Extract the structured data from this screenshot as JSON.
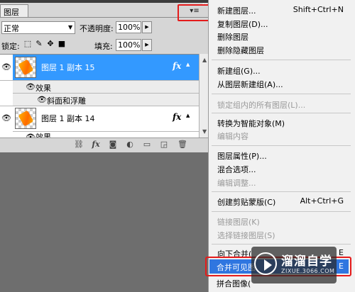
{
  "panel": {
    "tab_label": "图层",
    "menu_button_glyph": "▾≡",
    "blend_mode": "正常",
    "opacity_label": "不透明度:",
    "opacity_value": "100%",
    "lock_label": "锁定:",
    "fill_label": "填充:",
    "fill_value": "100%",
    "layers": [
      {
        "name": "图层 1 副本 15",
        "selected": true,
        "effects_label": "效果",
        "effect_item": "斜面和浮雕"
      },
      {
        "name": "图层 1 副本 14",
        "selected": false,
        "effects_label": "效果"
      }
    ],
    "fx_glyph": "fx"
  },
  "menu": {
    "items": [
      {
        "label": "新建图层...",
        "shortcut": "Shift+Ctrl+N",
        "disabled": false
      },
      {
        "label": "复制图层(D)...",
        "disabled": false
      },
      {
        "label": "删除图层",
        "disabled": false
      },
      {
        "label": "删除隐藏图层",
        "disabled": false
      },
      {
        "label": "新建组(G)...",
        "disabled": false
      },
      {
        "label": "从图层新建组(A)...",
        "disabled": false
      },
      {
        "label": "锁定组内的所有图层(L)...",
        "disabled": true
      },
      {
        "label": "转换为智能对象(M)",
        "disabled": false
      },
      {
        "label": "编辑内容",
        "disabled": true
      },
      {
        "label": "图层属性(P)...",
        "disabled": false
      },
      {
        "label": "混合选项...",
        "disabled": false
      },
      {
        "label": "编辑调整...",
        "disabled": true
      },
      {
        "label": "创建剪贴蒙版(C)",
        "shortcut": "Alt+Ctrl+G",
        "disabled": false
      },
      {
        "label": "链接图层(K)",
        "disabled": true
      },
      {
        "label": "选择链接图层(S)",
        "disabled": true
      },
      {
        "label": "向下合并(",
        "shortcut": "E",
        "disabled": false
      },
      {
        "label": "合并可见图",
        "shortcut": "E",
        "disabled": false,
        "highlighted": true
      },
      {
        "label": "拼合图像(",
        "disabled": false
      }
    ]
  },
  "watermark": {
    "text": "溜溜自学",
    "url": "ZIXUE.3066.COM"
  },
  "colors": {
    "selection": "#3399ff",
    "menu_highlight": "#2f76e0",
    "annotation": "#e41b1b"
  }
}
